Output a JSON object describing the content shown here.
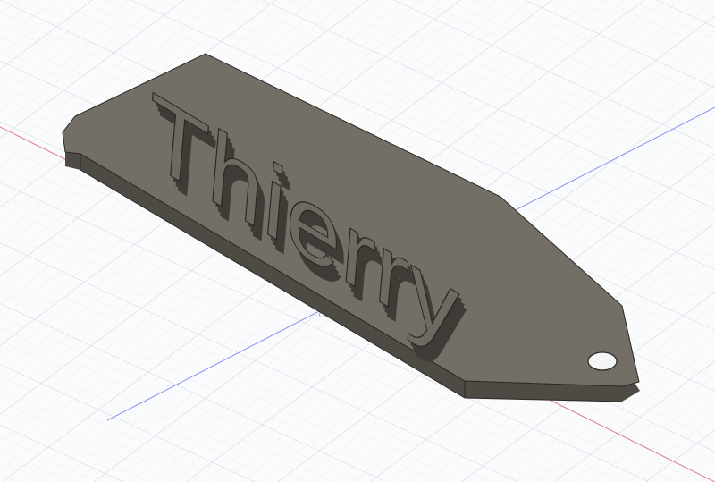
{
  "model": {
    "name_text": "Thierry",
    "colors": {
      "background": "#fafbfc",
      "grid_minor": "#e3e6ea",
      "grid_major": "#cfd4da",
      "axis_red": "#e07a7a",
      "axis_blue": "#8a8ff0",
      "plate_top": "#746f66",
      "plate_side": "#4e4b45",
      "plate_side_light": "#6a665e",
      "letter_face": "#6f6a61",
      "letter_extrude": "#3f3c37",
      "edge": "#2a2825",
      "keyring_hole": "#f4f5f6"
    },
    "icons": {
      "keyring_hole": "keyring-hole-icon",
      "origin": "origin-point-icon"
    }
  }
}
